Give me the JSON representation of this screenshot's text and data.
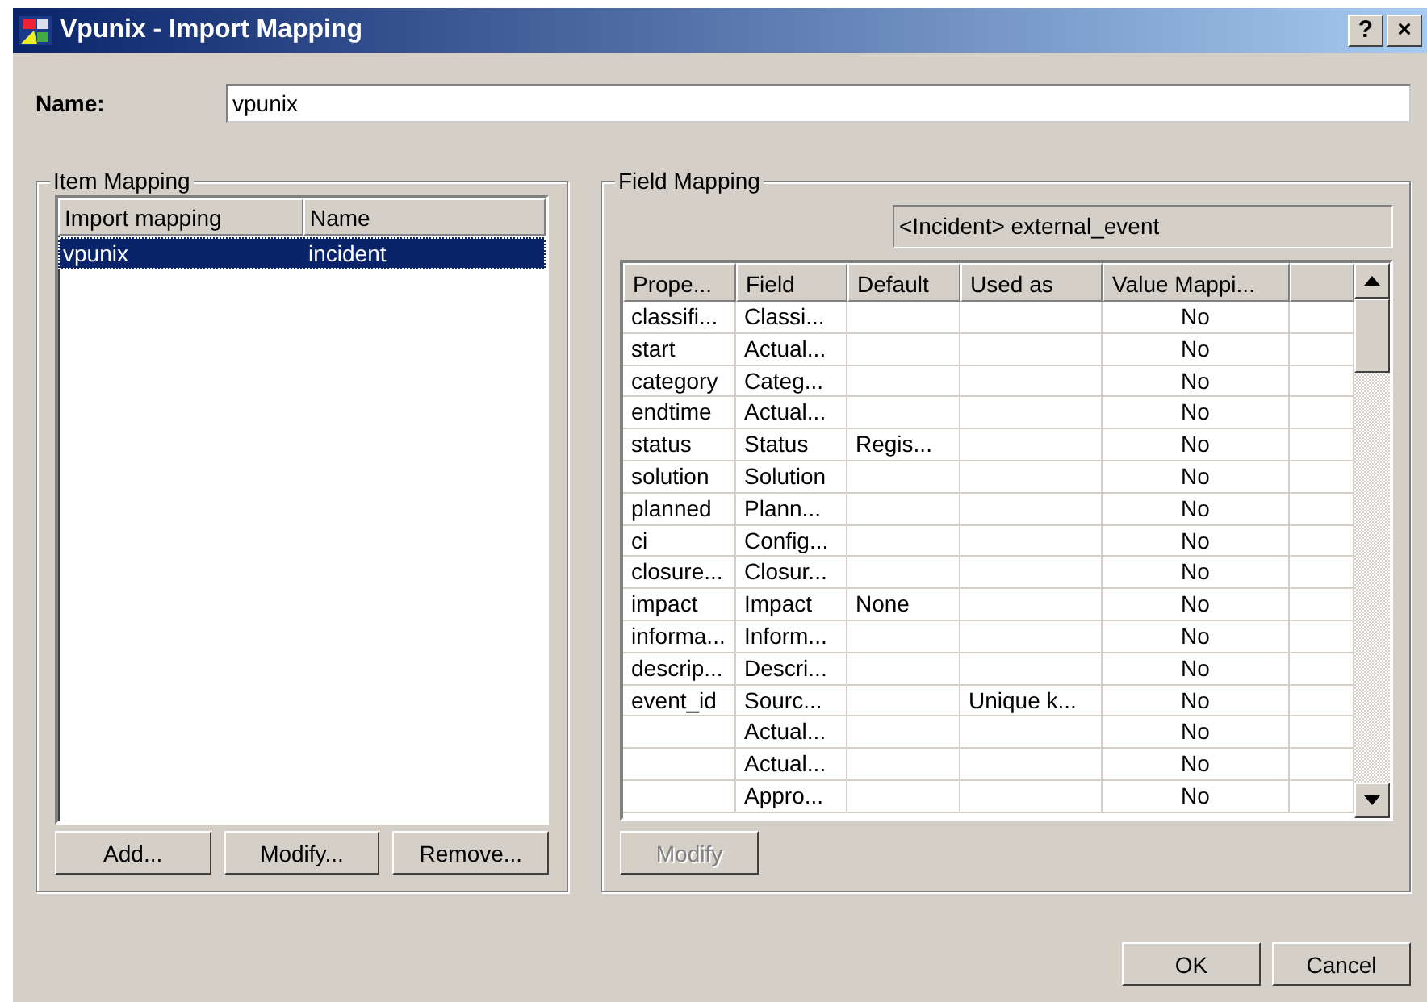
{
  "window": {
    "title": "Vpunix - Import Mapping",
    "help_button": "?",
    "close_button": "×"
  },
  "name": {
    "label": "Name:",
    "value": "vpunix"
  },
  "item_mapping": {
    "title": "Item Mapping",
    "columns": [
      "Import mapping",
      "Name"
    ],
    "rows": [
      {
        "cells": [
          "vpunix",
          "incident"
        ],
        "selected": true
      }
    ],
    "buttons": [
      {
        "label": "Add...",
        "disabled": false
      },
      {
        "label": "Modify...",
        "disabled": false
      },
      {
        "label": "Remove...",
        "disabled": false
      }
    ]
  },
  "field_mapping": {
    "title": "Field Mapping",
    "target": "<Incident> external_event",
    "columns": [
      "Prope...",
      "Field",
      "Default",
      "Used as",
      "Value Mappi..."
    ],
    "rows": [
      {
        "cells": [
          "classifi...",
          "Classi...",
          "",
          "",
          "No"
        ]
      },
      {
        "cells": [
          "start",
          "Actual...",
          "",
          "",
          "No"
        ]
      },
      {
        "cells": [
          "category",
          "Categ...",
          "",
          "",
          "No"
        ]
      },
      {
        "cells": [
          "endtime",
          "Actual...",
          "",
          "",
          "No"
        ]
      },
      {
        "cells": [
          "status",
          "Status",
          "Regis...",
          "",
          "No"
        ]
      },
      {
        "cells": [
          "solution",
          "Solution",
          "",
          "",
          "No"
        ]
      },
      {
        "cells": [
          "planned",
          "Plann...",
          "",
          "",
          "No"
        ]
      },
      {
        "cells": [
          "ci",
          "Config...",
          "",
          "",
          "No"
        ]
      },
      {
        "cells": [
          "closure...",
          "Closur...",
          "",
          "",
          "No"
        ]
      },
      {
        "cells": [
          "impact",
          "Impact",
          "None",
          "",
          "No"
        ]
      },
      {
        "cells": [
          "informa...",
          "Inform...",
          "",
          "",
          "No"
        ]
      },
      {
        "cells": [
          "descrip...",
          "Descri...",
          "",
          "",
          "No"
        ]
      },
      {
        "cells": [
          "event_id",
          "Sourc...",
          "",
          "Unique k...",
          "No"
        ]
      },
      {
        "cells": [
          "",
          "Actual...",
          "",
          "",
          "No"
        ]
      },
      {
        "cells": [
          "",
          "Actual...",
          "",
          "",
          "No"
        ]
      },
      {
        "cells": [
          "",
          "Appro...",
          "",
          "",
          "No"
        ]
      }
    ],
    "button": {
      "label": "Modify",
      "disabled": true
    }
  },
  "footer_buttons": [
    {
      "label": "OK"
    },
    {
      "label": "Cancel"
    }
  ]
}
